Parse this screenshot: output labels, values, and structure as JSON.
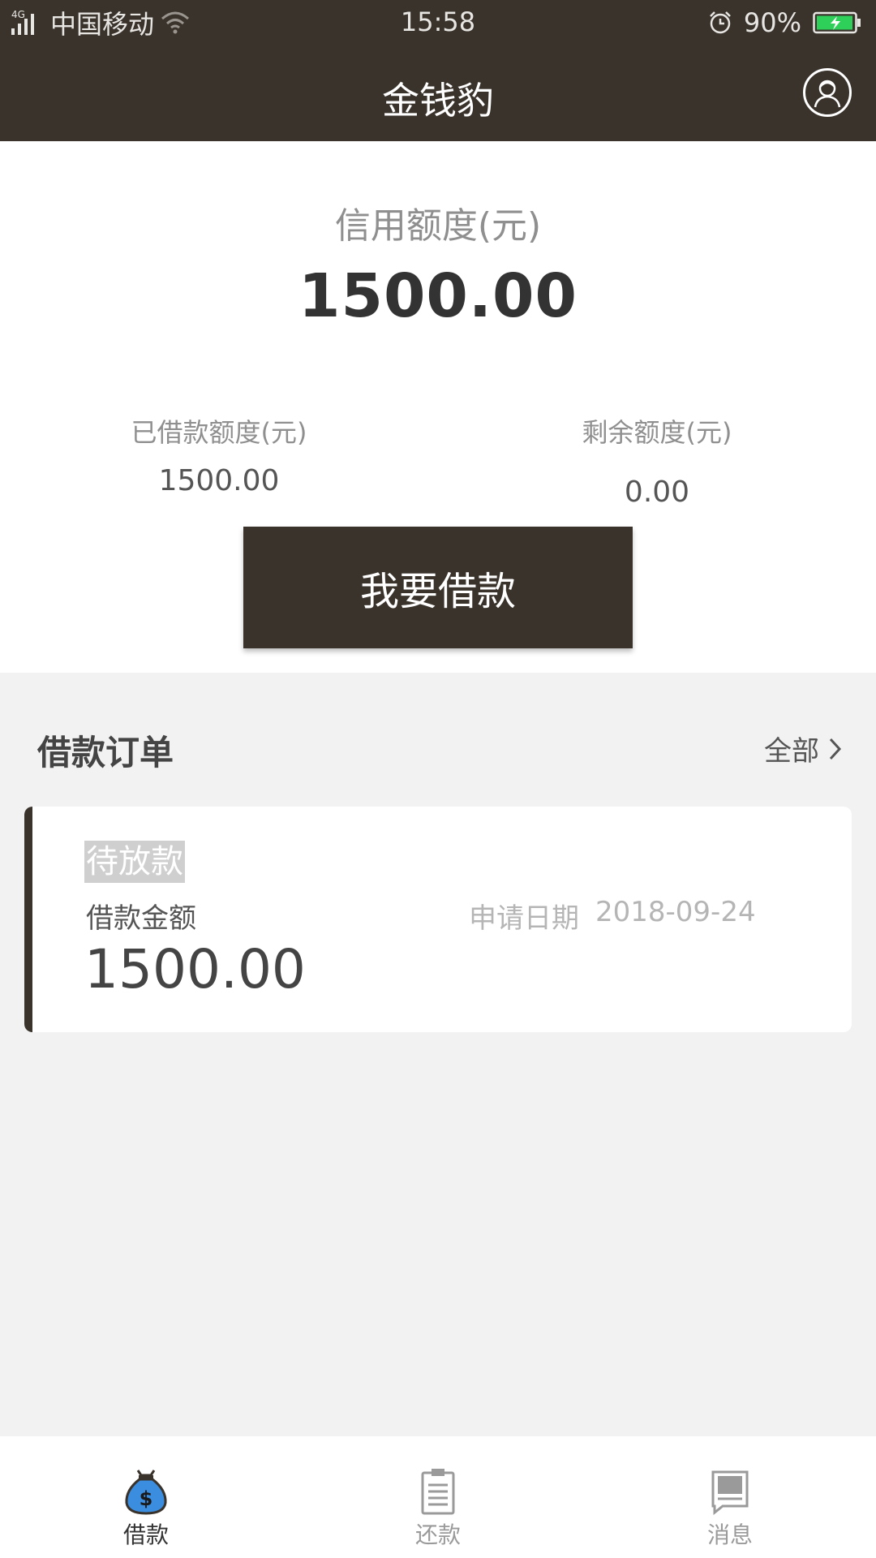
{
  "status_bar": {
    "network": "4G",
    "carrier": "中国移动",
    "time": "15:58",
    "battery": "90%"
  },
  "nav": {
    "title": "金钱豹",
    "icons": {
      "profile": "user-avatar-icon"
    }
  },
  "summary": {
    "credit_label": "信用额度(元)",
    "credit_value": "1500.00",
    "borrowed_label": "已借款额度(元)",
    "borrowed_value": "1500.00",
    "remaining_label": "剩余额度(元)",
    "remaining_value": "0.00",
    "borrow_button": "我要借款"
  },
  "orders": {
    "title": "借款订单",
    "view_all": "全部",
    "items": [
      {
        "status": "待放款",
        "amount_label": "借款金额",
        "amount": "1500.00",
        "date_label": "申请日期",
        "date": "2018-09-24"
      }
    ]
  },
  "tab_bar": {
    "tabs": [
      {
        "label": "借款",
        "icon": "money-bag-icon",
        "active": true
      },
      {
        "label": "还款",
        "icon": "clipboard-icon",
        "active": false
      },
      {
        "label": "消息",
        "icon": "message-icon",
        "active": false
      }
    ]
  },
  "colors": {
    "primary_dark": "#3a332c",
    "active_icon": "#3b8de0",
    "background": "#f1f2f1",
    "battery_green": "#2fd05a"
  }
}
